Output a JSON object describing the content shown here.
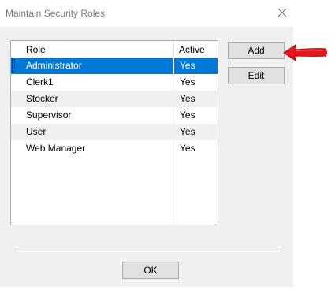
{
  "window": {
    "title": "Maintain Security Roles"
  },
  "list": {
    "headers": {
      "role": "Role",
      "active": "Active"
    },
    "rows": [
      {
        "role": "Administrator",
        "active": "Yes"
      },
      {
        "role": "Clerk1",
        "active": "Yes"
      },
      {
        "role": "Stocker",
        "active": "Yes"
      },
      {
        "role": "Supervisor",
        "active": "Yes"
      },
      {
        "role": "User",
        "active": "Yes"
      },
      {
        "role": "Web Manager",
        "active": "Yes"
      }
    ],
    "selected_index": 0
  },
  "buttons": {
    "add": "Add",
    "edit": "Edit",
    "ok": "OK"
  },
  "annotation": {
    "icon": "red-arrow-icon",
    "color": "#e8141b"
  },
  "colors": {
    "selection": "#0078d7"
  }
}
